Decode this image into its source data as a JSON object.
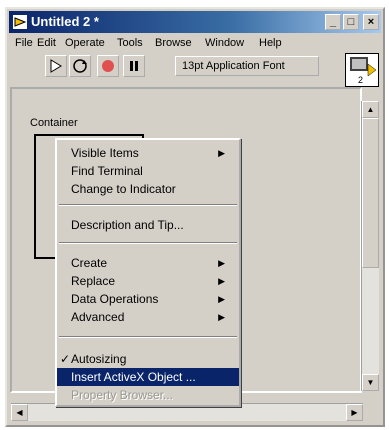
{
  "window": {
    "title": "Untitled 2 *",
    "minimize_glyph": "_",
    "maximize_glyph": "□",
    "close_glyph": "×"
  },
  "menubar": [
    "File",
    "Edit",
    "Operate",
    "Tools",
    "Browse",
    "Window",
    "Help"
  ],
  "toolbar": {
    "font_select": "13pt Application Font"
  },
  "vi_icon": {
    "number": "2"
  },
  "panel": {
    "container_label": "Container"
  },
  "context_menu": {
    "items": [
      {
        "label": "Visible Items",
        "submenu": true
      },
      {
        "label": "Find Terminal"
      },
      {
        "label": "Change to Indicator"
      },
      {
        "label": "Description and Tip..."
      },
      {
        "label": "Create",
        "submenu": true
      },
      {
        "label": "Replace",
        "submenu": true
      },
      {
        "label": "Data Operations",
        "submenu": true
      },
      {
        "label": "Advanced",
        "submenu": true
      },
      {
        "label": "Autosizing",
        "checked": true
      },
      {
        "label": "Insert ActiveX Object ...",
        "selected": true
      },
      {
        "label": "Property Browser...",
        "disabled": true
      }
    ],
    "submenu_arrow": "▶",
    "check_mark": "✓"
  },
  "colors": {
    "titlebar": "#0a246a",
    "selection": "#0a246a",
    "window_bg": "#d4d0c8"
  }
}
